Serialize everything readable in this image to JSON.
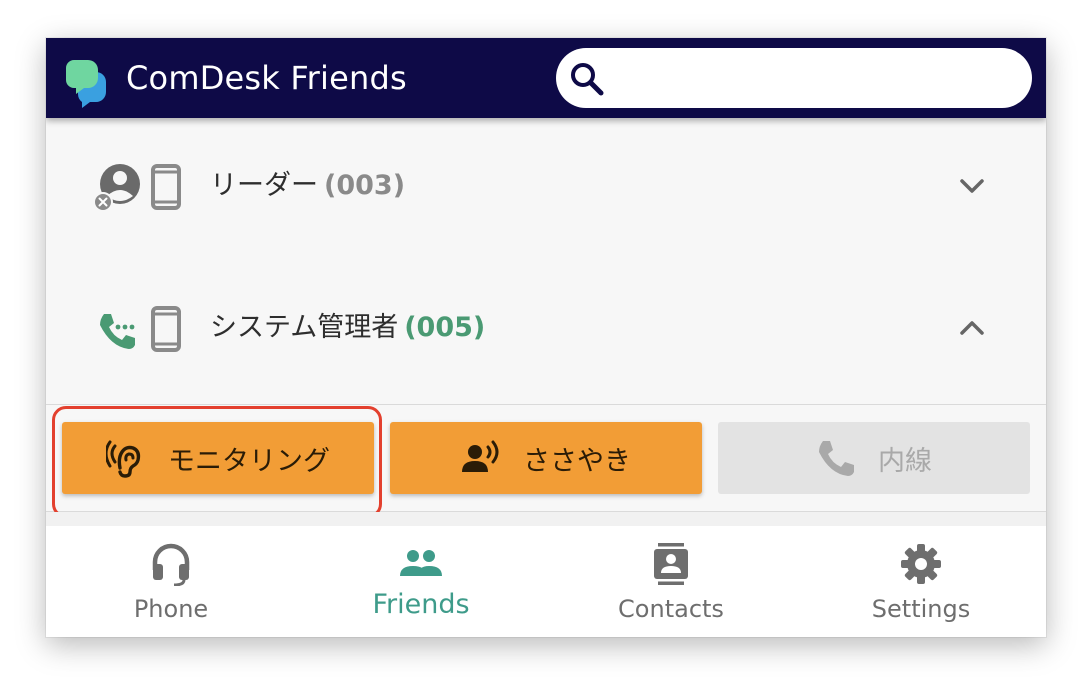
{
  "header": {
    "title": "ComDesk Friends",
    "search": {
      "placeholder": "",
      "value": ""
    },
    "logo_colors": [
      "#6fd6a0",
      "#3aa0e0"
    ]
  },
  "contacts": [
    {
      "name": "リーダー",
      "ext": "(003)",
      "status_icon": "user-offline-icon",
      "device_icon": "mobile-icon",
      "expanded": false,
      "ext_color": "#8a8a8a"
    },
    {
      "name": "システム管理者",
      "ext": "(005)",
      "status_icon": "phone-calling-icon",
      "device_icon": "mobile-icon",
      "expanded": true,
      "ext_color": "#4a9a73"
    }
  ],
  "actions": {
    "monitor": {
      "label": "モニタリング",
      "icon": "ear-icon",
      "enabled": true
    },
    "whisper": {
      "label": "ささやき",
      "icon": "speaking-person-icon",
      "enabled": true
    },
    "extension": {
      "label": "内線",
      "icon": "phone-icon",
      "enabled": false
    }
  },
  "nav": {
    "items": [
      {
        "label": "Phone",
        "icon": "headset-icon",
        "active": false
      },
      {
        "label": "Friends",
        "icon": "people-icon",
        "active": true
      },
      {
        "label": "Contacts",
        "icon": "contact-card-icon",
        "active": false
      },
      {
        "label": "Settings",
        "icon": "gear-icon",
        "active": false
      }
    ]
  },
  "colors": {
    "header_bg": "#0e0a47",
    "accent_orange": "#f29d36",
    "active_teal": "#3e9b8a",
    "highlight_red": "#e3402e"
  }
}
